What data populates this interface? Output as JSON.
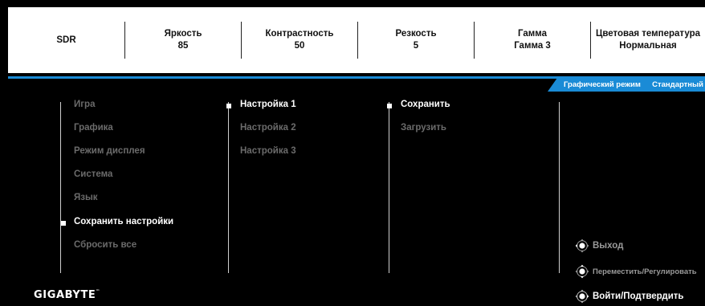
{
  "header": {
    "sdr_label": "SDR",
    "brightness": {
      "label": "Яркость",
      "value": "85"
    },
    "contrast": {
      "label": "Контрастность",
      "value": "50"
    },
    "sharpness": {
      "label": "Резкость",
      "value": "5"
    },
    "gamma": {
      "label": "Гамма",
      "value": "Гамма 3"
    },
    "color_temp": {
      "label": "Цветовая температура",
      "value": "Нормальная"
    }
  },
  "mode_tab": {
    "label": "Графический режим",
    "value": "Стандартный"
  },
  "main_menu": {
    "items": [
      {
        "label": "Игра"
      },
      {
        "label": "Графика"
      },
      {
        "label": "Режим дисплея"
      },
      {
        "label": "Система"
      },
      {
        "label": "Язык"
      },
      {
        "label": "Сохранить настройки"
      },
      {
        "label": "Сбросить все"
      }
    ],
    "selected_index": 5
  },
  "settings_menu": {
    "items": [
      {
        "label": "Настройка 1"
      },
      {
        "label": "Настройка 2"
      },
      {
        "label": "Настройка 3"
      }
    ],
    "selected_index": 0
  },
  "action_menu": {
    "items": [
      {
        "label": "Сохранить"
      },
      {
        "label": "Загрузить"
      }
    ],
    "selected_index": 0
  },
  "nav_hints": {
    "exit": {
      "label": "Выход",
      "icon": "joystick-left-icon"
    },
    "move": {
      "label": "Переместить/Регулировать",
      "icon": "joystick-updown-icon"
    },
    "enter": {
      "label": "Войти/Подтвердить",
      "icon": "joystick-right-icon"
    }
  },
  "brand": {
    "logo_text": "GIGABYTE",
    "trademark": "™"
  },
  "colors": {
    "accent": "#1a8bd6",
    "background": "#000000",
    "header_bg": "#ffffff",
    "inactive_text": "#6b6b6b"
  }
}
